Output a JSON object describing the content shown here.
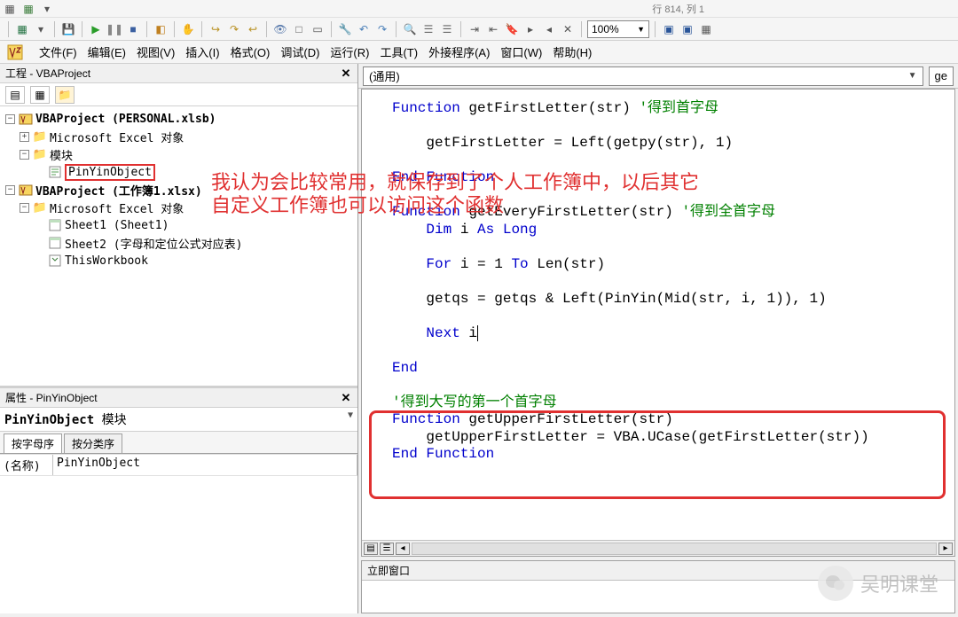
{
  "status": "行 814, 列 1",
  "zoom": "100%",
  "menu": {
    "file": "文件(F)",
    "edit": "编辑(E)",
    "view": "视图(V)",
    "insert": "插入(I)",
    "format": "格式(O)",
    "debug": "调试(D)",
    "run": "运行(R)",
    "tools": "工具(T)",
    "addins": "外接程序(A)",
    "window": "窗口(W)",
    "help": "帮助(H)"
  },
  "project_pane": {
    "title": "工程 - VBAProject",
    "tree": {
      "p1": "VBAProject (PERSONAL.xlsb)",
      "p1_excel": "Microsoft Excel 对象",
      "p1_modules": "模块",
      "p1_mod1": "PinYinObject",
      "p2": "VBAProject (工作簿1.xlsx)",
      "p2_excel": "Microsoft Excel 对象",
      "p2_s1": "Sheet1 (Sheet1)",
      "p2_s2": "Sheet2 (字母和定位公式对应表)",
      "p2_wb": "ThisWorkbook"
    }
  },
  "properties_pane": {
    "title": "属性 - PinYinObject",
    "object_name": "PinYinObject",
    "object_type": "模块",
    "tab1": "按字母序",
    "tab2": "按分类序",
    "row_label": "(名称)",
    "row_value": "PinYinObject"
  },
  "code_pane": {
    "combo_left": "(通用)",
    "combo_right": "ge",
    "immediate_title": "立即窗口",
    "lines": [
      {
        "t": "Function",
        "c": "kw"
      },
      {
        "t": " getFirstLetter(str) "
      },
      {
        "t": "'得到首字母",
        "c": "cm"
      },
      {
        "br": 1
      },
      {
        "br": 1
      },
      {
        "t": "    getFirstLetter = Left(getpy(str), 1)"
      },
      {
        "br": 1
      },
      {
        "br": 1
      },
      {
        "t": "End Function",
        "c": "kw"
      },
      {
        "br": 1
      },
      {
        "br": 1
      },
      {
        "t": "Function",
        "c": "kw"
      },
      {
        "t": " getEveryFirstLetter(str) "
      },
      {
        "t": "'得到全首字母",
        "c": "cm"
      },
      {
        "br": 1
      },
      {
        "t": "    "
      },
      {
        "t": "Dim",
        "c": "kw"
      },
      {
        "t": " i "
      },
      {
        "t": "As Long",
        "c": "kw"
      },
      {
        "br": 1
      },
      {
        "br": 1
      },
      {
        "t": "    "
      },
      {
        "t": "For",
        "c": "kw"
      },
      {
        "t": " i = 1 "
      },
      {
        "t": "To",
        "c": "kw"
      },
      {
        "t": " Len(str)"
      },
      {
        "br": 1
      },
      {
        "br": 1
      },
      {
        "t": "    getqs = getqs & Left(PinYin(Mid(str, i, 1)), 1)"
      },
      {
        "br": 1
      },
      {
        "br": 1
      },
      {
        "t": "    "
      },
      {
        "t": "Next",
        "c": "kw"
      },
      {
        "t": " i"
      },
      {
        "cursor": 1
      },
      {
        "br": 1
      },
      {
        "br": 1
      },
      {
        "t": "End",
        "c": "kw"
      },
      {
        "br": 1
      },
      {
        "br": 1
      },
      {
        "t": "'得到大写的第一个首字母",
        "c": "cm"
      },
      {
        "br": 1
      },
      {
        "t": "Function",
        "c": "kw"
      },
      {
        "t": " getUpperFirstLetter(str)"
      },
      {
        "br": 1
      },
      {
        "t": "    getUpperFirstLetter = VBA.UCase(getFirstLetter(str))"
      },
      {
        "br": 1
      },
      {
        "t": "End Function",
        "c": "kw"
      },
      {
        "br": 1
      }
    ]
  },
  "annotation": {
    "line1": "我认为会比较常用，就保存到了个人工作簿中，以后其它",
    "line2": "自定义工作簿也可以访问这个函数"
  },
  "watermark": "吴明课堂"
}
